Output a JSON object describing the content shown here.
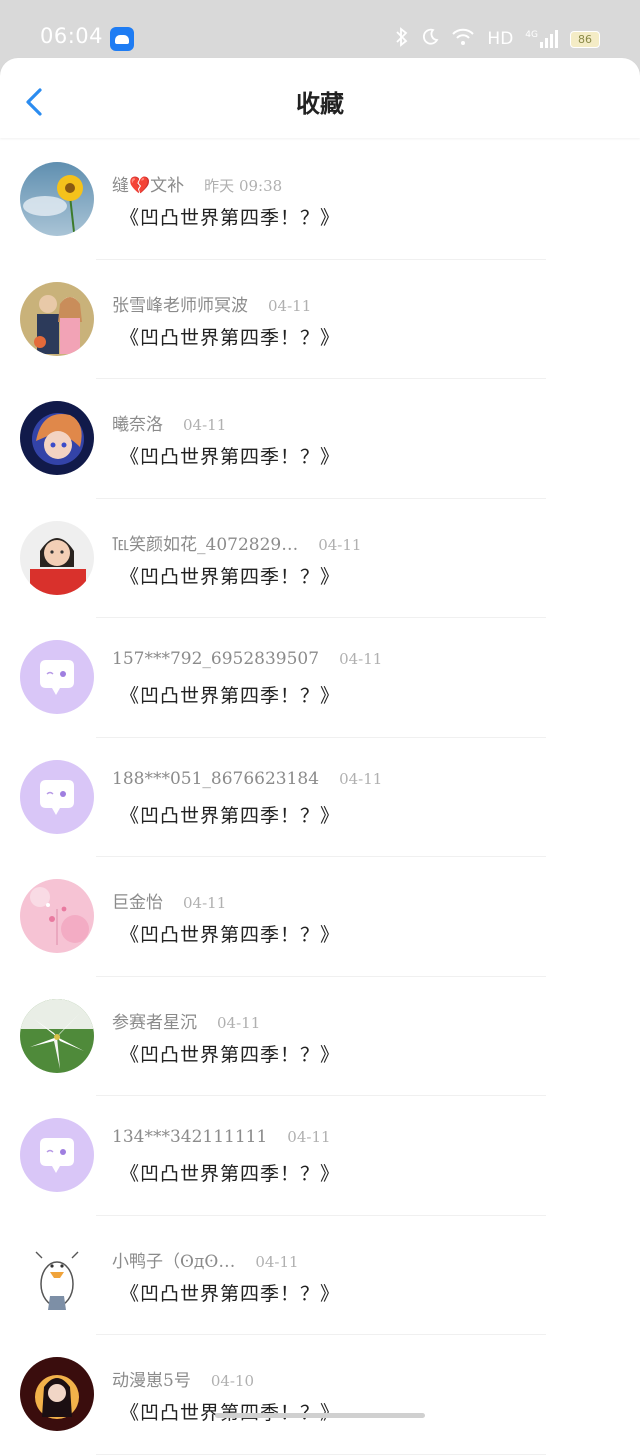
{
  "status_bar": {
    "time": "06:04",
    "network": "HD",
    "signal": "4G",
    "battery": "86"
  },
  "header": {
    "title": "收藏"
  },
  "items": [
    {
      "name": "缝💔文补",
      "time": "昨天 09:38",
      "content": "《凹凸世界第四季！？》",
      "avatar": "sunflower"
    },
    {
      "name": "张雪峰老师师冥波",
      "time": "04-11",
      "content": "《凹凸世界第四季！？》",
      "avatar": "couple"
    },
    {
      "name": "曦奈洛",
      "time": "04-11",
      "content": "《凹凸世界第四季！？》",
      "avatar": "anime"
    },
    {
      "name": "℡笑颜如花_4072829…",
      "time": "04-11",
      "content": "《凹凸世界第四季！？》",
      "avatar": "girl"
    },
    {
      "name": "157***792_6952839507",
      "time": "04-11",
      "content": "《凹凸世界第四季！？》",
      "avatar": "default"
    },
    {
      "name": "188***051_8676623184",
      "time": "04-11",
      "content": "《凹凸世界第四季！？》",
      "avatar": "default"
    },
    {
      "name": "巨金怡",
      "time": "04-11",
      "content": "《凹凸世界第四季！？》",
      "avatar": "pink"
    },
    {
      "name": "参赛者星沉",
      "time": "04-11",
      "content": "《凹凸世界第四季！？》",
      "avatar": "lily"
    },
    {
      "name": "134***342111111",
      "time": "04-11",
      "content": "《凹凸世界第四季！？》",
      "avatar": "default"
    },
    {
      "name": "小鸭子（ʘдʘ…",
      "time": "04-11",
      "content": "《凹凸世界第四季！？》",
      "avatar": "duck"
    },
    {
      "name": "动漫崽5号",
      "time": "04-10",
      "content": "《凹凸世界第四季！？》",
      "avatar": "dark"
    }
  ],
  "colors": {
    "accent": "#2b8cf0",
    "default_avatar": "#d9c6f7"
  }
}
